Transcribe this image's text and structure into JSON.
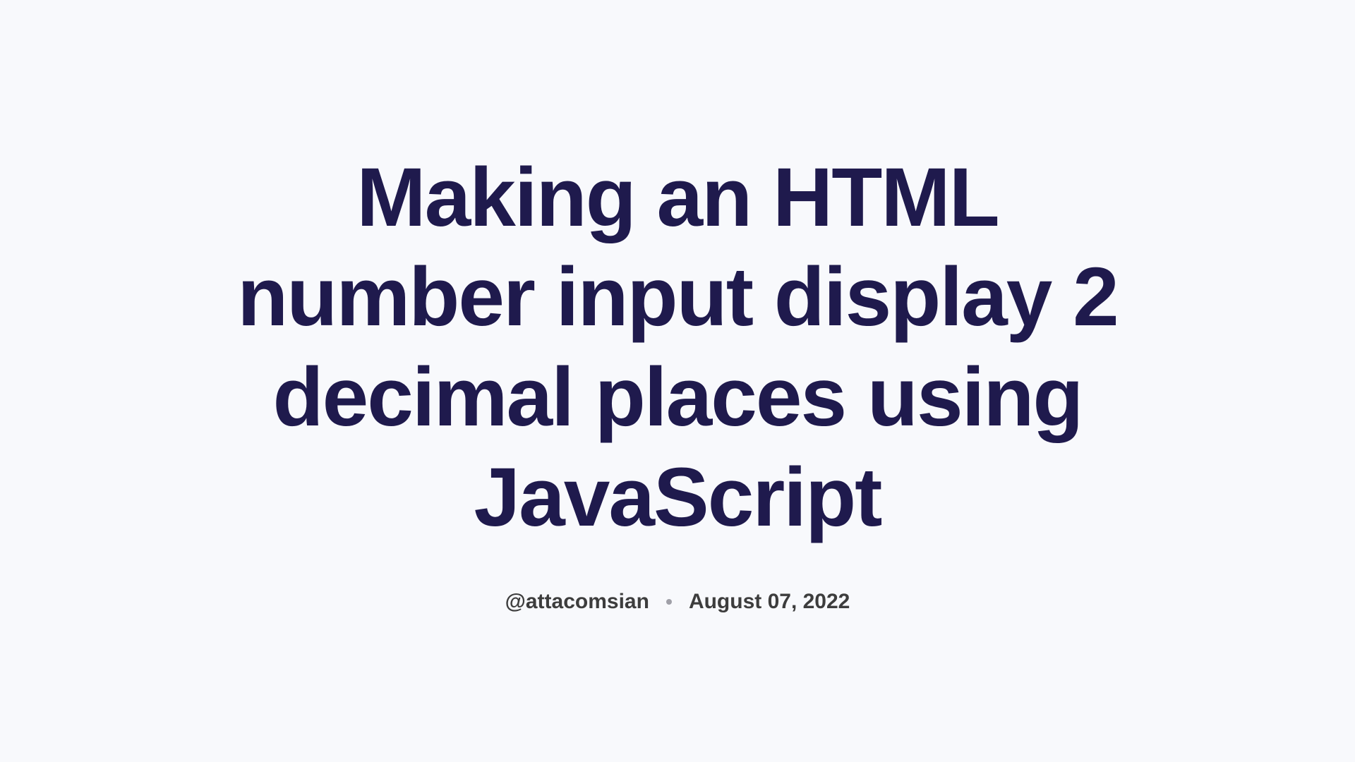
{
  "article": {
    "title": "Making an HTML number input display 2 decimal places using JavaScript",
    "author": "@attacomsian",
    "date": "August 07, 2022"
  }
}
